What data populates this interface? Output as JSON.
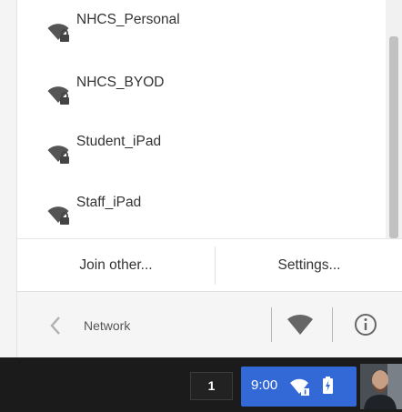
{
  "networks": [
    {
      "name": "NHCS_Personal",
      "icon": "wifi-locked-icon"
    },
    {
      "name": "NHCS_BYOD",
      "icon": "wifi-locked-icon"
    },
    {
      "name": "Student_iPad",
      "icon": "wifi-locked-icon"
    },
    {
      "name": "Staff_iPad",
      "icon": "wifi-locked-icon"
    }
  ],
  "actions": {
    "join_label": "Join other...",
    "settings_label": "Settings..."
  },
  "footer": {
    "title": "Network",
    "back_icon": "chevron-left-icon",
    "wifi_icon": "wifi-toggle-icon",
    "info_icon": "info-icon"
  },
  "shelf": {
    "badge": "1",
    "time": "9:00",
    "wifi_icon": "wifi-locked-icon",
    "battery_icon": "battery-charging-icon"
  },
  "colors": {
    "status_area": "#3369d6",
    "shelf": "#1b1b1b",
    "footer": "#f5f5f5",
    "text": "#333333"
  }
}
